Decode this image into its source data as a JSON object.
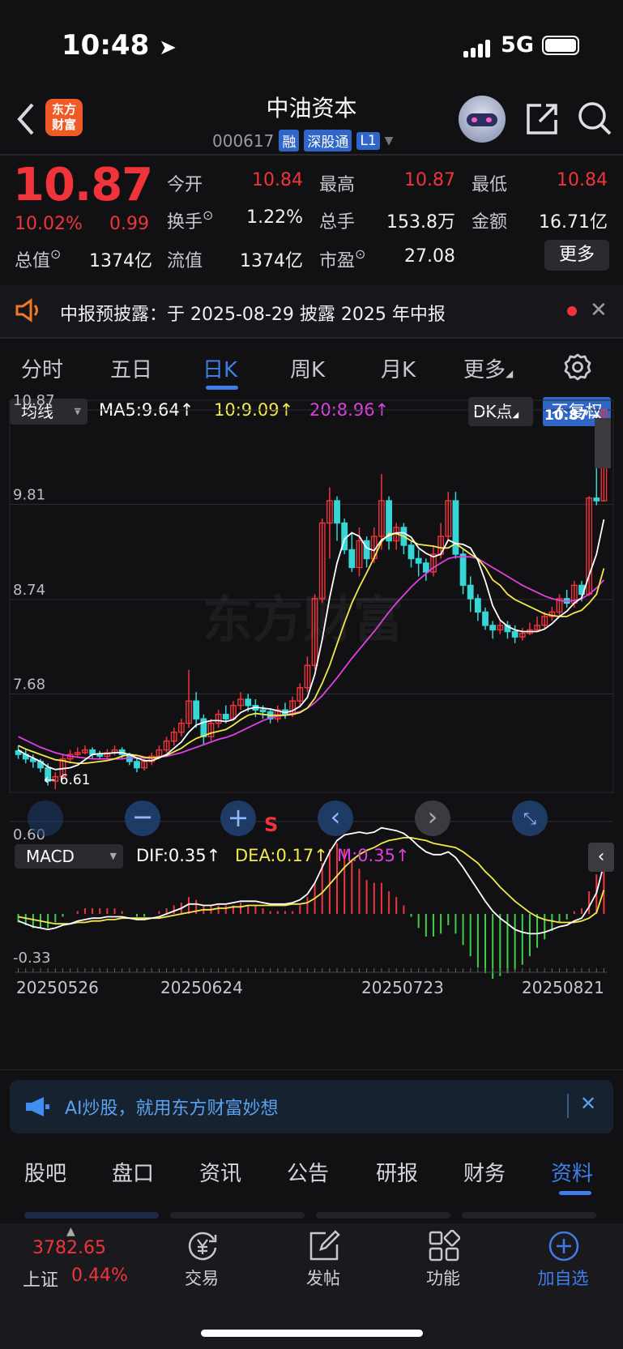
{
  "status": {
    "time": "10:48",
    "network": "5G"
  },
  "header": {
    "logo_line1": "东方",
    "logo_line2": "财富",
    "name": "中油资本",
    "code": "000617",
    "tags": [
      "融",
      "深股通",
      "L1"
    ]
  },
  "quote": {
    "price": "10.87",
    "pct": "10.02%",
    "change": "0.99",
    "fields": [
      {
        "label": "今开",
        "value": "10.84",
        "color": "red"
      },
      {
        "label": "最高",
        "value": "10.87",
        "color": "red"
      },
      {
        "label": "最低",
        "value": "10.84",
        "color": "red"
      },
      {
        "label": "换手",
        "value": "1.22%",
        "color": "white"
      },
      {
        "label": "总手",
        "value": "153.8万",
        "color": "white"
      },
      {
        "label": "金额",
        "value": "16.71亿",
        "color": "white"
      },
      {
        "label": "总值",
        "value": "1374亿",
        "color": "white"
      },
      {
        "label": "流值",
        "value": "1374亿",
        "color": "white"
      },
      {
        "label": "市盈",
        "value": "27.08",
        "color": "white"
      }
    ],
    "more_label": "更多"
  },
  "notice": {
    "text": "中报预披露：于 2025-08-29 披露 2025 年中报"
  },
  "period_tabs": [
    "分时",
    "五日",
    "日K",
    "周K",
    "月K",
    "更多"
  ],
  "kline": {
    "indicator": "均线",
    "ma5": "MA5:9.64",
    "ma10": "10:9.09",
    "ma20": "20:8.96",
    "dk_label": "DK点",
    "fq_label": "不复权",
    "last_price_label": "10.87→",
    "min_label": "6.61",
    "s_mark": "S",
    "watermark": "东方财富"
  },
  "macd": {
    "indicator": "MACD",
    "dif": "DIF:0.35",
    "dea": "DEA:0.17",
    "m": "M:0.35"
  },
  "dates": [
    "20250526",
    "20250624",
    "20250723",
    "20250821"
  ],
  "ai_banner": {
    "text": "AI炒股，就用东方财富妙想"
  },
  "bottom_tabs": [
    "股吧",
    "盘口",
    "资讯",
    "公告",
    "研报",
    "财务",
    "资料"
  ],
  "toolbar": {
    "index_value": "3782.65",
    "index_name": "上证",
    "index_pct": "0.44%",
    "items": [
      "交易",
      "发帖",
      "功能",
      "加自选"
    ]
  },
  "chart_data": {
    "type": "candlestick",
    "y_ticks": [
      "10.87",
      "9.81",
      "8.74",
      "7.68"
    ],
    "macd_y_ticks": [
      "0.60",
      "-0.33"
    ],
    "ylim": [
      6.61,
      10.87
    ],
    "candles": [
      [
        7.04,
        7.0,
        7.1,
        6.95
      ],
      [
        7.0,
        6.95,
        7.05,
        6.9
      ],
      [
        6.95,
        6.92,
        7.0,
        6.85
      ],
      [
        6.92,
        6.85,
        6.95,
        6.8
      ],
      [
        6.85,
        6.7,
        6.9,
        6.65
      ],
      [
        6.7,
        6.75,
        6.8,
        6.61
      ],
      [
        6.75,
        6.95,
        7.0,
        6.72
      ],
      [
        6.95,
        7.0,
        7.05,
        6.9
      ],
      [
        7.0,
        7.02,
        7.08,
        6.96
      ],
      [
        7.02,
        7.05,
        7.1,
        7.0
      ],
      [
        7.05,
        7.0,
        7.08,
        6.95
      ],
      [
        7.0,
        6.98,
        7.04,
        6.94
      ],
      [
        6.98,
        7.02,
        7.06,
        6.95
      ],
      [
        7.02,
        7.05,
        7.1,
        6.99
      ],
      [
        7.05,
        7.0,
        7.08,
        6.96
      ],
      [
        7.0,
        6.92,
        7.02,
        6.88
      ],
      [
        6.92,
        6.85,
        6.96,
        6.8
      ],
      [
        6.85,
        6.92,
        6.96,
        6.82
      ],
      [
        6.92,
        6.98,
        7.02,
        6.88
      ],
      [
        6.98,
        7.05,
        7.1,
        6.95
      ],
      [
        7.05,
        7.15,
        7.2,
        7.02
      ],
      [
        7.15,
        7.25,
        7.3,
        7.1
      ],
      [
        7.25,
        7.35,
        7.4,
        7.2
      ],
      [
        7.35,
        7.6,
        7.95,
        7.3
      ],
      [
        7.6,
        7.4,
        7.7,
        7.3
      ],
      [
        7.4,
        7.2,
        7.45,
        7.1
      ],
      [
        7.2,
        7.35,
        7.4,
        7.15
      ],
      [
        7.35,
        7.45,
        7.5,
        7.3
      ],
      [
        7.45,
        7.4,
        7.55,
        7.35
      ],
      [
        7.4,
        7.55,
        7.6,
        7.38
      ],
      [
        7.55,
        7.62,
        7.7,
        7.5
      ],
      [
        7.62,
        7.55,
        7.68,
        7.48
      ],
      [
        7.55,
        7.5,
        7.62,
        7.42
      ],
      [
        7.5,
        7.48,
        7.55,
        7.4
      ],
      [
        7.48,
        7.4,
        7.52,
        7.35
      ],
      [
        7.4,
        7.5,
        7.55,
        7.36
      ],
      [
        7.5,
        7.45,
        7.58,
        7.4
      ],
      [
        7.45,
        7.6,
        7.65,
        7.42
      ],
      [
        7.6,
        7.75,
        7.8,
        7.55
      ],
      [
        7.75,
        8.0,
        8.1,
        7.7
      ],
      [
        8.0,
        8.75,
        8.8,
        7.95
      ],
      [
        8.75,
        9.6,
        9.65,
        8.7
      ],
      [
        9.6,
        9.85,
        10.0,
        9.2
      ],
      [
        9.85,
        9.6,
        9.9,
        9.4
      ],
      [
        9.6,
        9.3,
        9.65,
        9.25
      ],
      [
        9.3,
        9.1,
        9.5,
        9.05
      ],
      [
        9.1,
        9.4,
        9.55,
        9.0
      ],
      [
        9.4,
        9.2,
        9.45,
        9.1
      ],
      [
        9.2,
        9.45,
        9.55,
        9.15
      ],
      [
        9.45,
        9.85,
        10.15,
        9.3
      ],
      [
        9.85,
        9.4,
        9.9,
        9.3
      ],
      [
        9.4,
        9.55,
        9.6,
        9.3
      ],
      [
        9.55,
        9.35,
        9.6,
        9.25
      ],
      [
        9.35,
        9.2,
        9.4,
        9.1
      ],
      [
        9.2,
        9.15,
        9.3,
        9.0
      ],
      [
        9.15,
        9.05,
        9.2,
        8.95
      ],
      [
        9.05,
        9.25,
        9.35,
        9.0
      ],
      [
        9.25,
        9.45,
        9.6,
        9.2
      ],
      [
        9.45,
        9.85,
        9.95,
        9.4
      ],
      [
        9.85,
        9.25,
        9.95,
        9.2
      ],
      [
        9.25,
        8.9,
        9.3,
        8.8
      ],
      [
        8.9,
        8.75,
        9.0,
        8.6
      ],
      [
        8.75,
        8.6,
        8.8,
        8.5
      ],
      [
        8.6,
        8.45,
        8.65,
        8.4
      ],
      [
        8.45,
        8.4,
        8.5,
        8.3
      ],
      [
        8.4,
        8.45,
        8.5,
        8.35
      ],
      [
        8.45,
        8.38,
        8.5,
        8.3
      ],
      [
        8.38,
        8.32,
        8.45,
        8.25
      ],
      [
        8.32,
        8.36,
        8.42,
        8.28
      ],
      [
        8.36,
        8.4,
        8.48,
        8.34
      ],
      [
        8.4,
        8.45,
        8.55,
        8.38
      ],
      [
        8.45,
        8.55,
        8.6,
        8.42
      ],
      [
        8.55,
        8.6,
        8.66,
        8.5
      ],
      [
        8.6,
        8.75,
        8.8,
        8.55
      ],
      [
        8.75,
        8.7,
        8.85,
        8.65
      ],
      [
        8.7,
        8.9,
        8.95,
        8.65
      ],
      [
        8.9,
        8.8,
        8.95,
        8.72
      ],
      [
        8.8,
        9.88,
        9.9,
        8.78
      ],
      [
        9.88,
        9.85,
        10.42,
        9.8
      ],
      [
        9.85,
        10.87,
        10.87,
        9.84
      ]
    ],
    "ma5": [
      7.05,
      7.0,
      6.96,
      6.92,
      6.86,
      6.83,
      6.84,
      6.85,
      6.88,
      6.94,
      7.0,
      7.01,
      7.01,
      7.02,
      7.02,
      7.0,
      6.96,
      6.93,
      6.93,
      6.96,
      7.0,
      7.07,
      7.14,
      7.25,
      7.33,
      7.36,
      7.38,
      7.38,
      7.37,
      7.39,
      7.47,
      7.51,
      7.53,
      7.52,
      7.51,
      7.49,
      7.47,
      7.49,
      7.54,
      7.64,
      7.9,
      8.29,
      8.76,
      9.15,
      9.42,
      9.49,
      9.45,
      9.32,
      9.29,
      9.41,
      9.46,
      9.49,
      9.49,
      9.44,
      9.32,
      9.26,
      9.22,
      9.25,
      9.41,
      9.37,
      9.36,
      9.32,
      9.18,
      8.95,
      8.67,
      8.51,
      8.44,
      8.4,
      8.38,
      8.38,
      8.38,
      8.41,
      8.47,
      8.55,
      8.61,
      8.7,
      8.76,
      9.01,
      9.25,
      9.64
    ],
    "ma10": [
      7.1,
      7.06,
      7.03,
      7.0,
      6.97,
      6.94,
      6.93,
      6.91,
      6.9,
      6.9,
      6.91,
      6.92,
      6.93,
      6.95,
      6.98,
      7.0,
      6.99,
      6.97,
      6.96,
      6.97,
      6.99,
      7.03,
      7.07,
      7.13,
      7.18,
      7.21,
      7.24,
      7.26,
      7.28,
      7.33,
      7.39,
      7.44,
      7.46,
      7.45,
      7.44,
      7.44,
      7.44,
      7.45,
      7.47,
      7.52,
      7.63,
      7.8,
      8.0,
      8.24,
      8.48,
      8.7,
      8.88,
      9.04,
      9.21,
      9.39,
      9.48,
      9.48,
      9.45,
      9.4,
      9.36,
      9.35,
      9.34,
      9.32,
      9.32,
      9.37,
      9.31,
      9.25,
      9.2,
      9.1,
      8.96,
      8.9,
      8.8,
      8.74,
      8.7,
      8.66,
      8.62,
      8.58,
      8.56,
      8.55,
      8.55,
      8.59,
      8.62,
      8.7,
      8.8,
      9.09
    ],
    "ma20": [
      7.2,
      7.16,
      7.12,
      7.08,
      7.05,
      7.02,
      7.0,
      6.98,
      6.97,
      6.96,
      6.95,
      6.95,
      6.95,
      6.95,
      6.95,
      6.96,
      6.96,
      6.96,
      6.96,
      6.97,
      6.98,
      7.0,
      7.02,
      7.05,
      7.08,
      7.11,
      7.14,
      7.17,
      7.19,
      7.22,
      7.26,
      7.3,
      7.34,
      7.38,
      7.41,
      7.43,
      7.44,
      7.46,
      7.48,
      7.52,
      7.58,
      7.66,
      7.76,
      7.86,
      7.97,
      8.08,
      8.18,
      8.28,
      8.38,
      8.49,
      8.6,
      8.7,
      8.79,
      8.88,
      8.96,
      9.03,
      9.1,
      9.15,
      9.2,
      9.22,
      9.22,
      9.22,
      9.2,
      9.15,
      9.1,
      9.05,
      9.0,
      8.95,
      8.9,
      8.86,
      8.82,
      8.78,
      8.75,
      8.73,
      8.72,
      8.73,
      8.75,
      8.8,
      8.87,
      8.96
    ],
    "macd_dif": [
      -0.05,
      -0.07,
      -0.09,
      -0.1,
      -0.11,
      -0.1,
      -0.08,
      -0.07,
      -0.05,
      -0.04,
      -0.03,
      -0.03,
      -0.02,
      -0.02,
      -0.02,
      -0.03,
      -0.04,
      -0.04,
      -0.03,
      -0.02,
      0.0,
      0.02,
      0.04,
      0.07,
      0.07,
      0.06,
      0.06,
      0.07,
      0.07,
      0.08,
      0.09,
      0.09,
      0.09,
      0.08,
      0.07,
      0.07,
      0.07,
      0.08,
      0.1,
      0.14,
      0.22,
      0.33,
      0.44,
      0.52,
      0.56,
      0.57,
      0.58,
      0.57,
      0.58,
      0.61,
      0.6,
      0.59,
      0.57,
      0.53,
      0.48,
      0.44,
      0.42,
      0.42,
      0.44,
      0.4,
      0.33,
      0.25,
      0.17,
      0.09,
      0.02,
      -0.03,
      -0.07,
      -0.11,
      -0.13,
      -0.14,
      -0.14,
      -0.13,
      -0.11,
      -0.09,
      -0.08,
      -0.05,
      -0.03,
      0.05,
      0.15,
      0.35
    ],
    "macd_dea": [
      -0.02,
      -0.03,
      -0.04,
      -0.05,
      -0.06,
      -0.07,
      -0.07,
      -0.07,
      -0.06,
      -0.06,
      -0.05,
      -0.05,
      -0.04,
      -0.04,
      -0.03,
      -0.03,
      -0.03,
      -0.03,
      -0.03,
      -0.03,
      -0.02,
      -0.01,
      0.0,
      0.01,
      0.02,
      0.03,
      0.03,
      0.04,
      0.04,
      0.05,
      0.05,
      0.06,
      0.06,
      0.06,
      0.06,
      0.06,
      0.06,
      0.07,
      0.07,
      0.08,
      0.11,
      0.15,
      0.21,
      0.27,
      0.33,
      0.38,
      0.42,
      0.45,
      0.47,
      0.5,
      0.52,
      0.53,
      0.54,
      0.54,
      0.53,
      0.52,
      0.5,
      0.49,
      0.48,
      0.47,
      0.44,
      0.4,
      0.36,
      0.3,
      0.25,
      0.19,
      0.14,
      0.09,
      0.05,
      0.01,
      -0.02,
      -0.04,
      -0.05,
      -0.06,
      -0.06,
      -0.06,
      -0.05,
      -0.03,
      0.01,
      0.17
    ]
  }
}
